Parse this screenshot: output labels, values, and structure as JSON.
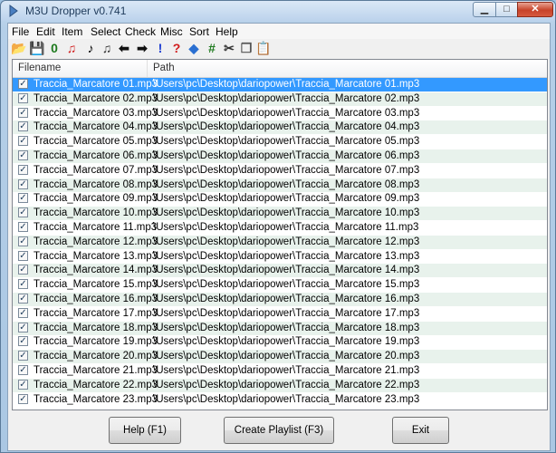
{
  "window": {
    "title": "M3U Dropper v0.741"
  },
  "menu": [
    "File",
    "Edit",
    "Item",
    "Select",
    "Check",
    "Misc",
    "Sort",
    "Help"
  ],
  "toolbar": [
    {
      "icon": "open-folder-icon",
      "glyph": "📂",
      "color": "#c9a33a"
    },
    {
      "icon": "save-icon",
      "glyph": "💾",
      "color": "#222222"
    },
    {
      "icon": "zero-icon",
      "glyph": "0",
      "color": "#1e7a1e"
    },
    {
      "icon": "music-note-red-icon",
      "glyph": "♫",
      "color": "#d11a1a"
    },
    {
      "icon": "music-note-icon",
      "glyph": "♪",
      "color": "#000000"
    },
    {
      "icon": "music-note-plus-icon",
      "glyph": "♫",
      "color": "#333333"
    },
    {
      "icon": "arrow-left-icon",
      "glyph": "⬅",
      "color": "#111111"
    },
    {
      "icon": "arrow-right-icon",
      "glyph": "➡",
      "color": "#111111"
    },
    {
      "icon": "exclamation-icon",
      "glyph": "!",
      "color": "#1a3ad1"
    },
    {
      "icon": "question-icon",
      "glyph": "?",
      "color": "#d11a1a"
    },
    {
      "icon": "diamond-icon",
      "glyph": "◆",
      "color": "#2a6fd1"
    },
    {
      "icon": "hash-icon",
      "glyph": "#",
      "color": "#1e7a1e"
    },
    {
      "icon": "scissors-icon",
      "glyph": "✂",
      "color": "#333333"
    },
    {
      "icon": "copy-icon",
      "glyph": "❐",
      "color": "#555555"
    },
    {
      "icon": "paste-icon",
      "glyph": "📋",
      "color": "#8a6a2a"
    }
  ],
  "list": {
    "columns": [
      "Filename",
      "Path"
    ],
    "rows": [
      {
        "name": "Traccia_Marcatore 01.mp3",
        "path": "\\Users\\pc\\Desktop\\dariopower\\Traccia_Marcatore 01.mp3",
        "checked": true,
        "selected": true
      },
      {
        "name": "Traccia_Marcatore 02.mp3",
        "path": "\\Users\\pc\\Desktop\\dariopower\\Traccia_Marcatore 02.mp3",
        "checked": true
      },
      {
        "name": "Traccia_Marcatore 03.mp3",
        "path": "\\Users\\pc\\Desktop\\dariopower\\Traccia_Marcatore 03.mp3",
        "checked": true
      },
      {
        "name": "Traccia_Marcatore 04.mp3",
        "path": "\\Users\\pc\\Desktop\\dariopower\\Traccia_Marcatore 04.mp3",
        "checked": true
      },
      {
        "name": "Traccia_Marcatore 05.mp3",
        "path": "\\Users\\pc\\Desktop\\dariopower\\Traccia_Marcatore 05.mp3",
        "checked": true
      },
      {
        "name": "Traccia_Marcatore 06.mp3",
        "path": "\\Users\\pc\\Desktop\\dariopower\\Traccia_Marcatore 06.mp3",
        "checked": true
      },
      {
        "name": "Traccia_Marcatore 07.mp3",
        "path": "\\Users\\pc\\Desktop\\dariopower\\Traccia_Marcatore 07.mp3",
        "checked": true
      },
      {
        "name": "Traccia_Marcatore 08.mp3",
        "path": "\\Users\\pc\\Desktop\\dariopower\\Traccia_Marcatore 08.mp3",
        "checked": true
      },
      {
        "name": "Traccia_Marcatore 09.mp3",
        "path": "\\Users\\pc\\Desktop\\dariopower\\Traccia_Marcatore 09.mp3",
        "checked": true
      },
      {
        "name": "Traccia_Marcatore 10.mp3",
        "path": "\\Users\\pc\\Desktop\\dariopower\\Traccia_Marcatore 10.mp3",
        "checked": true
      },
      {
        "name": "Traccia_Marcatore 11.mp3",
        "path": "\\Users\\pc\\Desktop\\dariopower\\Traccia_Marcatore 11.mp3",
        "checked": true
      },
      {
        "name": "Traccia_Marcatore 12.mp3",
        "path": "\\Users\\pc\\Desktop\\dariopower\\Traccia_Marcatore 12.mp3",
        "checked": true
      },
      {
        "name": "Traccia_Marcatore 13.mp3",
        "path": "\\Users\\pc\\Desktop\\dariopower\\Traccia_Marcatore 13.mp3",
        "checked": true
      },
      {
        "name": "Traccia_Marcatore 14.mp3",
        "path": "\\Users\\pc\\Desktop\\dariopower\\Traccia_Marcatore 14.mp3",
        "checked": true
      },
      {
        "name": "Traccia_Marcatore 15.mp3",
        "path": "\\Users\\pc\\Desktop\\dariopower\\Traccia_Marcatore 15.mp3",
        "checked": true
      },
      {
        "name": "Traccia_Marcatore 16.mp3",
        "path": "\\Users\\pc\\Desktop\\dariopower\\Traccia_Marcatore 16.mp3",
        "checked": true
      },
      {
        "name": "Traccia_Marcatore 17.mp3",
        "path": "\\Users\\pc\\Desktop\\dariopower\\Traccia_Marcatore 17.mp3",
        "checked": true
      },
      {
        "name": "Traccia_Marcatore 18.mp3",
        "path": "\\Users\\pc\\Desktop\\dariopower\\Traccia_Marcatore 18.mp3",
        "checked": true
      },
      {
        "name": "Traccia_Marcatore 19.mp3",
        "path": "\\Users\\pc\\Desktop\\dariopower\\Traccia_Marcatore 19.mp3",
        "checked": true
      },
      {
        "name": "Traccia_Marcatore 20.mp3",
        "path": "\\Users\\pc\\Desktop\\dariopower\\Traccia_Marcatore 20.mp3",
        "checked": true
      },
      {
        "name": "Traccia_Marcatore 21.mp3",
        "path": "\\Users\\pc\\Desktop\\dariopower\\Traccia_Marcatore 21.mp3",
        "checked": true
      },
      {
        "name": "Traccia_Marcatore 22.mp3",
        "path": "\\Users\\pc\\Desktop\\dariopower\\Traccia_Marcatore 22.mp3",
        "checked": true
      },
      {
        "name": "Traccia_Marcatore 23.mp3",
        "path": "\\Users\\pc\\Desktop\\dariopower\\Traccia_Marcatore 23.mp3",
        "checked": true
      }
    ]
  },
  "buttons": {
    "help": "Help (F1)",
    "create": "Create Playlist (F3)",
    "exit": "Exit"
  }
}
